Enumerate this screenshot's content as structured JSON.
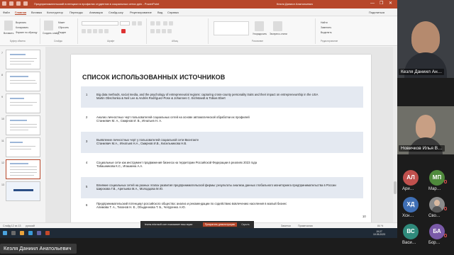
{
  "window": {
    "title": "Предпринимательский потенциал в профилях студентов в социальных сетях.pptx - PowerPoint",
    "user": "Кезля Даниил Анатольевич",
    "controls": [
      "—",
      "❐",
      "✕"
    ]
  },
  "menu": {
    "items": [
      "Файл",
      "Главная",
      "Вставка",
      "Конструктор",
      "Переходы",
      "Анимация",
      "Слайд-шоу",
      "Рецензирование",
      "Вид",
      "Справка"
    ],
    "active": "Главная",
    "share": "Поделиться"
  },
  "ribbon": {
    "groups": [
      "Буфер обмена",
      "Слайды",
      "Шрифт",
      "Абзац",
      "Рисование",
      "Редактирование"
    ],
    "clipboard": {
      "paste": "Вставить",
      "cut": "Вырезать",
      "copy": "Копировать",
      "format": "Формат по образцу"
    },
    "slides": {
      "new_slide": "Создать слайд",
      "layout": "Макет",
      "reset": "Сбросить",
      "section": "Раздел"
    },
    "drawing": {
      "arrange": "Упорядочить",
      "quick_styles": "Экспресс-стили"
    },
    "editing": {
      "find": "Найти",
      "replace": "Заменить",
      "select": "Выделить"
    }
  },
  "thumbnails": {
    "numbers": [
      "7",
      "8",
      "9",
      "10",
      "11",
      "12",
      "13"
    ],
    "selected": "12"
  },
  "slide": {
    "title": "СПИСОК ИСПОЛЬЗОВАННЫХ ИСТОЧНИКОВ",
    "page_number": "10",
    "references": [
      {
        "num": "1",
        "lines": [
          "Big data methods, social media, and the psychology of entrepreneurial regions: capturing cross-county personality traits and their impact on entrepreneurship in the USA",
          "Martin Obschonka & Neil Lee & Andrés Rodríguez-Pose & Johannes C. Eichstaedt & Tobias Ebert"
        ]
      },
      {
        "num": "2",
        "lines": [
          "Анализ личностных черт пользователей социальных сетей на основе автоматической обработки их профилей",
          "Станкевич М. А., Смирнов И. В., Игнатьев Н. А."
        ]
      },
      {
        "num": "3",
        "lines": [
          "Выявление личностных черт у пользователей социальной сети Вконтакте",
          "Станкевич М.А., Игнатьев Н.А., Смирнов И.В., Кисельникова Н.В."
        ]
      },
      {
        "num": "4",
        "lines": [
          "Социальные сети как инструмент продвижения бизнеса на территории Российской Федерации в реалиях 2023 года",
          "Табашникова К.С., Игашкина А.А."
        ]
      },
      {
        "num": "5",
        "lines": [
          "Влияние социальных сетей на разных этапах развития предпринимательской фирмы: результаты анализа данных глобального мониторинга предпринимательства в России",
          "Широкова Г.В., Арепьева М.А., Молодцова М.Ю."
        ]
      },
      {
        "num": "6",
        "lines": [
          "Предпринимательский потенциал российского общества: анализ и рекомендации по содействию вовлечению населения в малый бизнес",
          "Алимова Т. А., Тихонов Н. Е., Обыденнова Т. Б., Чепуренко А.Ю."
        ]
      }
    ]
  },
  "statusbar": {
    "slide_info": "Слайд 12 из 13",
    "language": "русский",
    "notes": "Заметки",
    "comments": "Примечания",
    "zoom": "84 %"
  },
  "notification": {
    "text": "teams.microsoft.com показывает ваш экран",
    "stop": "Прекратить демонстрацию",
    "hide": "Скрыть"
  },
  "taskbar": {
    "time": "19:27",
    "date": "10.05.2023"
  },
  "speaker_label": "Кезля Даниил Анатольевич",
  "participants": {
    "main": [
      {
        "name": "Кезля Даниил Ан…"
      },
      {
        "name": "Новичков Илья В…"
      }
    ],
    "avatars": [
      {
        "initials": "АЛ",
        "name": "Ари…",
        "color": "#c0504d"
      },
      {
        "initials": "МП",
        "name": "Мар…",
        "color": "#4f8a3c"
      },
      {
        "initials": "ХД",
        "name": "Хсн…",
        "color": "#3f6fb5"
      },
      {
        "initials": "",
        "name": "Сво…",
        "color": "#8b8b8b"
      },
      {
        "initials": "ВС",
        "name": "Васи…",
        "color": "#2f8a7b"
      },
      {
        "initials": "БА",
        "name": "Бор…",
        "color": "#7a5aa8"
      }
    ]
  }
}
